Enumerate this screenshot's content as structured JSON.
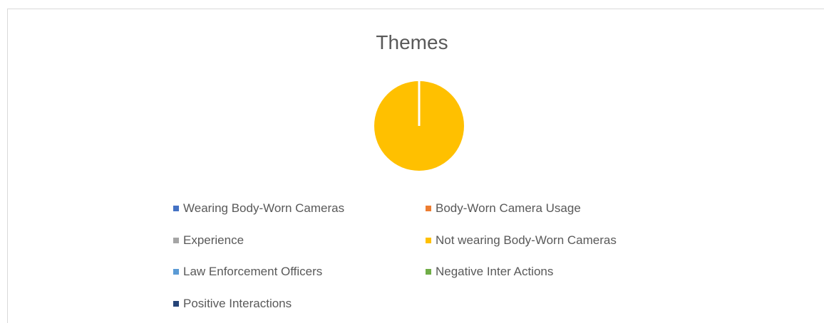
{
  "chart_data": {
    "type": "pie",
    "title": "Themes",
    "categories": [
      "Wearing Body-Worn Cameras",
      "Body-Worn Camera Usage",
      "Experience",
      "Not wearing Body-Worn Cameras",
      "Law Enforcement Officers",
      "Negative Inter Actions",
      "Positive Interactions"
    ],
    "values": [
      0,
      0,
      0,
      100,
      0,
      0,
      0
    ],
    "colors": [
      "#4472C4",
      "#ED7D31",
      "#A5A5A5",
      "#FFC000",
      "#5B9BD5",
      "#70AD47",
      "#264478"
    ],
    "legend_position": "bottom"
  }
}
